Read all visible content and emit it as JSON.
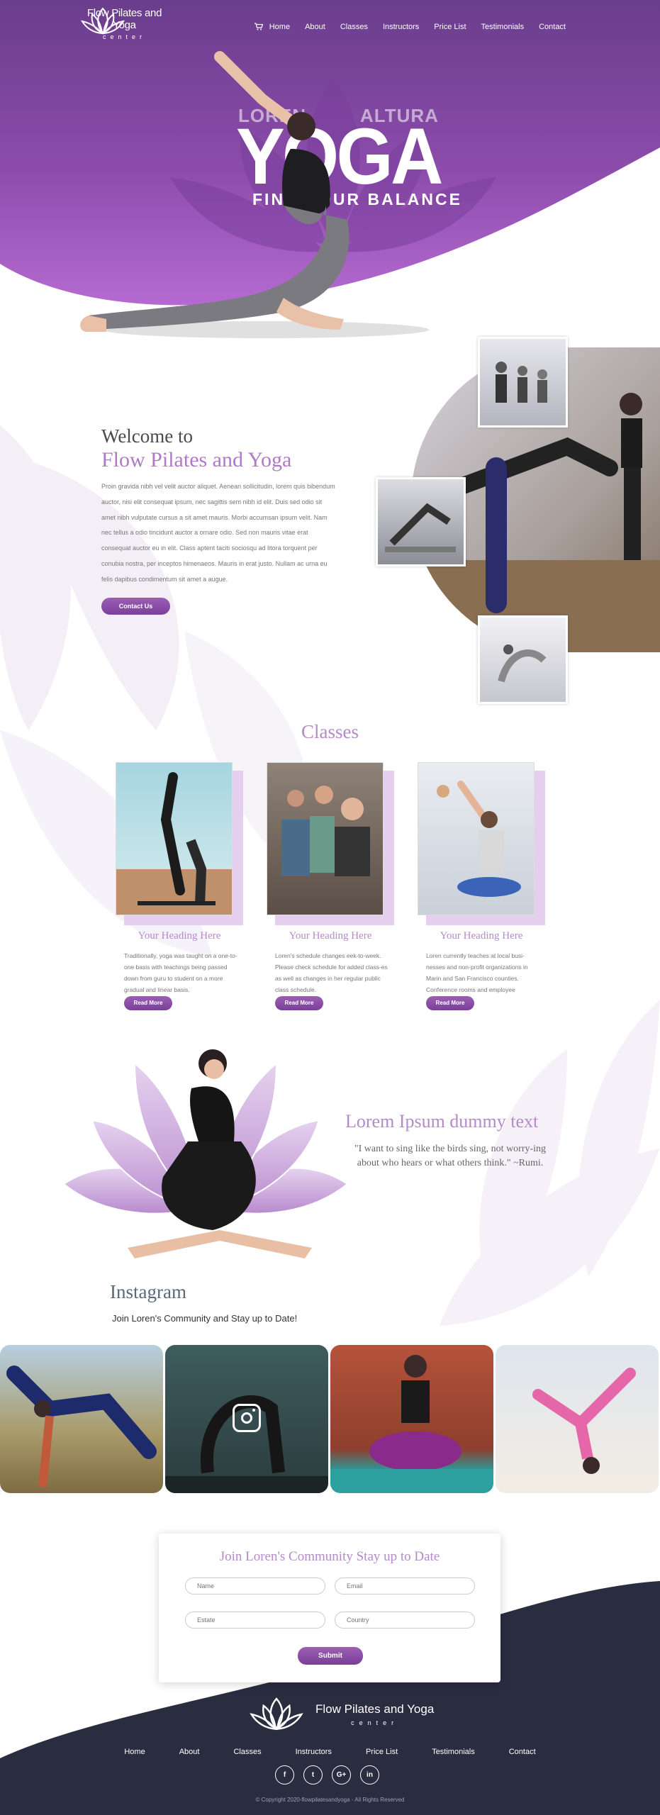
{
  "brand": {
    "name": "Flow Pilates and Yoga",
    "tagline": "center"
  },
  "nav": [
    "Home",
    "About",
    "Classes",
    "Instructors",
    "Price List",
    "Testimonials",
    "Contact"
  ],
  "hero": {
    "left_word": "LOREN",
    "right_word": "ALTURA",
    "title": "YOGA",
    "subtitle": "FIND YOUR BALANCE"
  },
  "welcome": {
    "title1": "Welcome to",
    "title2": "Flow Pilates and Yoga",
    "body": "Proin gravida nibh vel velit auctor aliquet. Aenean sollicitudin, lorem quis bibendum auctor, nisi elit consequat ipsum, nec sagittis sem nibh id elit. Duis sed odio sit amet nibh vulputate cursus a sit amet mauris. Morbi accumsan ipsum velit. Nam nec tellus a odio tincidunt auctor a ornare odio. Sed non mauris vitae erat consequat auctor eu in elit. Class aptent taciti sociosqu ad litora torquent per conubia nostra, per inceptos himenaeos. Mauris in erat justo. Nullam ac urna eu felis dapibus condimentum sit amet a augue.",
    "button": "Contact Us"
  },
  "classes": {
    "title": "Classes",
    "cards": [
      {
        "heading": "Your Heading Here",
        "text": "Traditionally, yoga was taught on a one-to-one basis with teachings being passed down from guru to student on a more gradual and linear basis.",
        "button": "Read More"
      },
      {
        "heading": "Your Heading Here",
        "text": "Loren's schedule changes eek-to-week. Please check schedule for added class-es as well as changes in her regular public class schedule.",
        "button": "Read More"
      },
      {
        "heading": "Your Heading Here",
        "text": "Loren currently teaches at local busi-nesses and non-profit organizations in Marin and San Francisco counties. Conference rooms and employee",
        "button": "Read More"
      }
    ]
  },
  "quote": {
    "heading": "Lorem Ipsum dummy text",
    "text": "\"I want to sing like the birds sing, not worry-ing about who hears or what others think.\" ~Rumi."
  },
  "instagram": {
    "title": "Instagram",
    "subtitle": "Join Loren's Community and Stay up to Date!"
  },
  "signup": {
    "title": "Join Loren's Community Stay up to Date",
    "fields": {
      "name": "Name",
      "email": "Email",
      "estate": "Estate",
      "country": "Country"
    },
    "button": "Submit"
  },
  "footer": {
    "socials": [
      "f",
      "t",
      "G+",
      "in"
    ],
    "copyright": "© Copyright 2020-flowpilatesandyoga - All Rights Reserved"
  },
  "colors": {
    "purple": "#8a4fb0",
    "lavender": "#b58ac9",
    "navy": "#2a2d40"
  }
}
